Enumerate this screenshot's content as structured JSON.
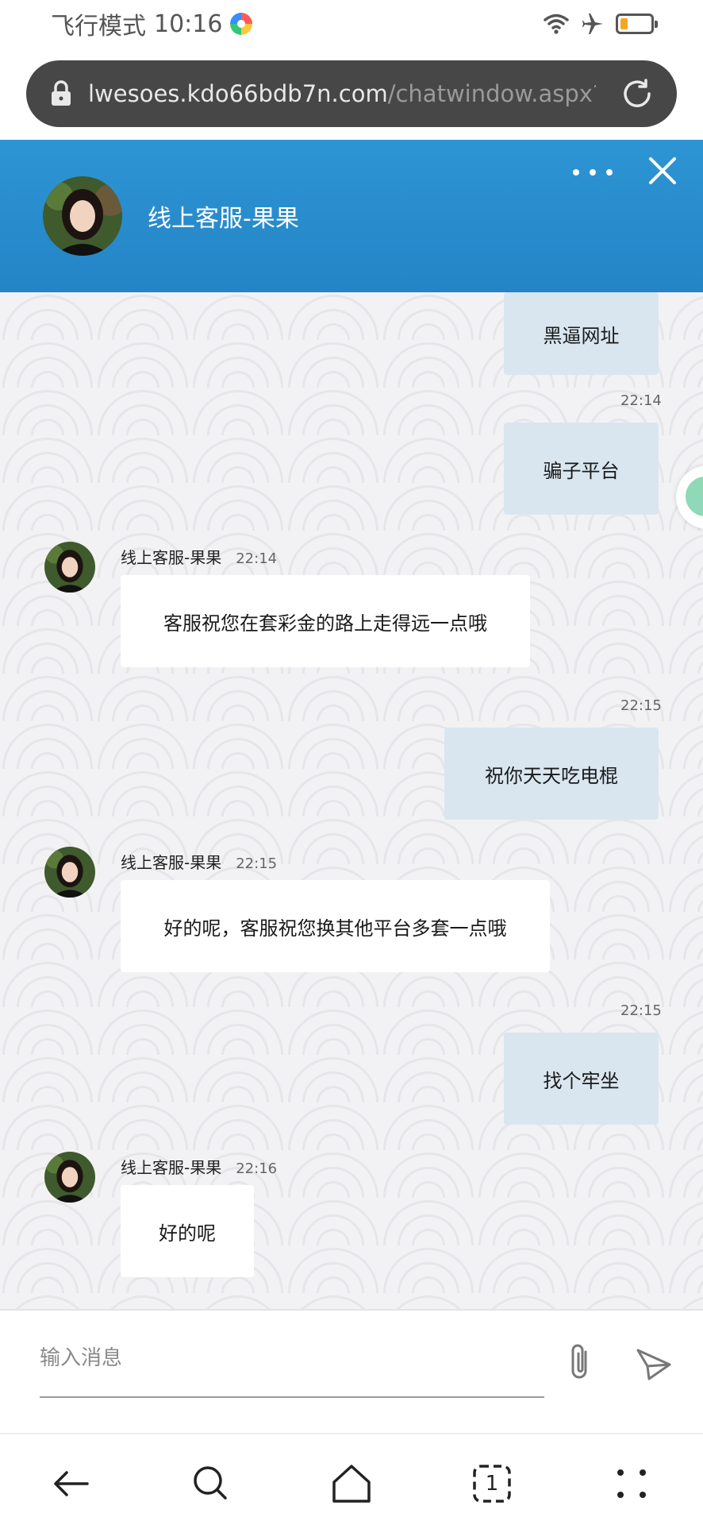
{
  "status_bar": {
    "mode": "飞行模式",
    "time": "10:16",
    "battery_level": 0.25
  },
  "browser": {
    "url_host": "lwesoes.kdo66bdb7n.com",
    "url_path": "/chatwindow.aspx?siteId"
  },
  "header": {
    "title": "线上客服-果果"
  },
  "messages": [
    {
      "sender": "me",
      "text": "黑逼网址"
    },
    {
      "sender": "me",
      "time": "22:14",
      "text": "骗子平台"
    },
    {
      "sender": "agent",
      "name": "线上客服-果果",
      "time": "22:14",
      "text": "客服祝您在套彩金的路上走得远一点哦"
    },
    {
      "sender": "me",
      "time": "22:15",
      "text": "祝你天天吃电棍"
    },
    {
      "sender": "agent",
      "name": "线上客服-果果",
      "time": "22:15",
      "text": "好的呢，客服祝您换其他平台多套一点哦"
    },
    {
      "sender": "me",
      "time": "22:15",
      "text": "找个牢坐"
    },
    {
      "sender": "agent",
      "name": "线上客服-果果",
      "time": "22:16",
      "text": "好的呢"
    }
  ],
  "input": {
    "placeholder": "输入消息"
  },
  "icons": {
    "lock": "lock-icon",
    "reload": "reload-icon",
    "more": "more-icon",
    "close": "close-icon",
    "attach": "paperclip-icon",
    "send": "send-icon",
    "nav": [
      "back-icon",
      "search-icon",
      "home-icon",
      "tabs-icon",
      "menu-icon"
    ]
  },
  "nav": {
    "tab_count": "1"
  },
  "colors": {
    "header": "#2a8fd0",
    "my_bubble": "#d9e6f0",
    "agent_bubble": "#ffffff",
    "url_bar": "#474747",
    "battery": "#f5a623"
  }
}
